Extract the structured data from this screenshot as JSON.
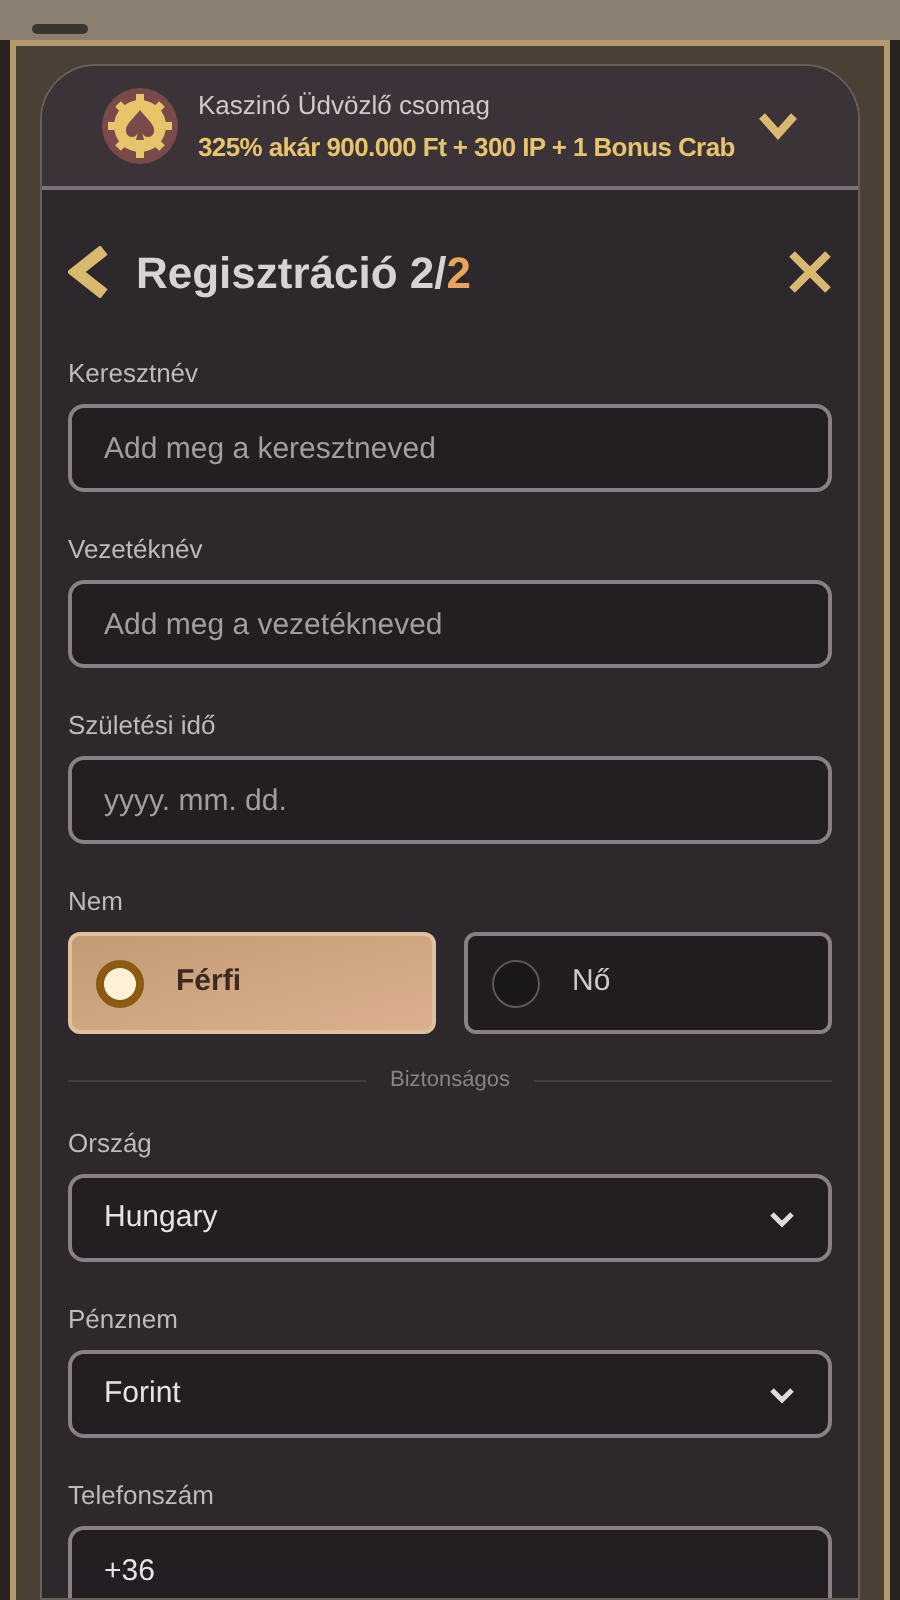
{
  "promo": {
    "title": "Kaszinó Üdvözlő csomag",
    "offer": "325% akár 900.000 Ft + 300 IP + 1 Bonus Crab"
  },
  "header": {
    "title": "Regisztráció 2/",
    "step": "2"
  },
  "fields": [
    {
      "kind": "text",
      "label": "Keresztnév",
      "placeholder": "Add meg a keresztneved"
    },
    {
      "kind": "text",
      "label": "Vezetéknév",
      "placeholder": "Add meg a vezetékneved"
    },
    {
      "kind": "text",
      "label": "Születési idő",
      "placeholder": "yyyy. mm. dd."
    },
    {
      "kind": "radio",
      "label": "Nem",
      "options": [
        {
          "label": "Férfi",
          "selected": true
        },
        {
          "label": "Nő",
          "selected": false
        }
      ]
    },
    {
      "kind": "divider",
      "label": "Biztonságos"
    },
    {
      "kind": "select",
      "label": "Ország",
      "value": "Hungary"
    },
    {
      "kind": "select",
      "label": "Pénznem",
      "value": "Forint"
    },
    {
      "kind": "text",
      "label": "Telefonszám",
      "value": "+36"
    }
  ]
}
